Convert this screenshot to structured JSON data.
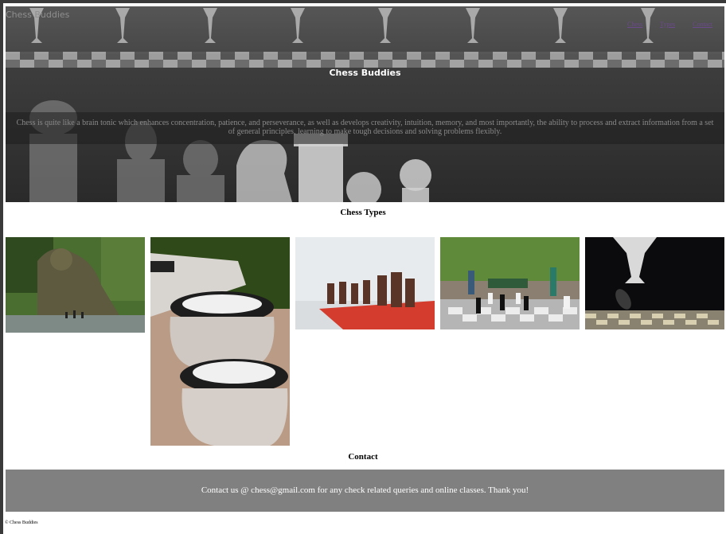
{
  "brand": "Chess Buddies",
  "nav": {
    "links": [
      "Chess",
      "Types",
      "Contact"
    ]
  },
  "hero": {
    "title": "Chess Buddies",
    "text": "Chess is quite like a brain tonic which enhances concentration, patience, and perseverance, as well as develops creativity, intuition, memory, and most importantly, the ability to process and extract information from a set of general principles, learning to make tough decisions and solving problems flexibly."
  },
  "types": {
    "title": "Chess Types",
    "images": [
      {
        "name": "statue-chess-image"
      },
      {
        "name": "stone-table-chess-image"
      },
      {
        "name": "red-board-chess-image"
      },
      {
        "name": "park-giant-chess-image"
      },
      {
        "name": "dark-chess-pieces-image"
      }
    ]
  },
  "contact": {
    "title": "Contact",
    "text": "Contact us @ chess@gmail.com for any check related queries and online classes. Thank you!"
  },
  "footer": {
    "text": "© Chess Buddies"
  },
  "colors": {
    "hero_bg": "#3a3a3a",
    "contact_bg": "#808080",
    "nav_link": "#6a4a8a"
  }
}
